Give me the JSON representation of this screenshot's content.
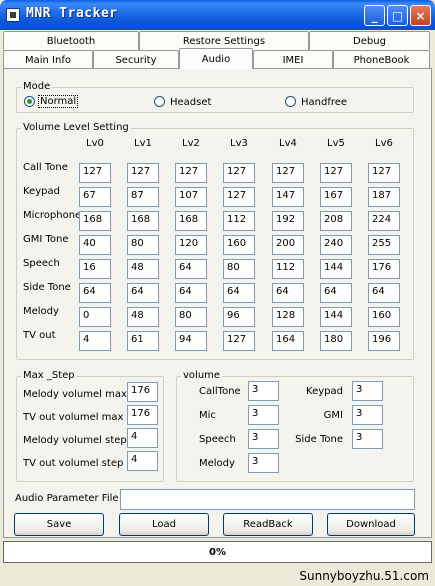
{
  "window": {
    "title": "MNR Tracker",
    "minimize": "_",
    "maximize": "□",
    "close": "×"
  },
  "tabs": {
    "row1": [
      "Bluetooth",
      "Restore Settings",
      "Debug"
    ],
    "row2": [
      "Main Info",
      "Security",
      "Audio",
      "IMEI",
      "PhoneBook"
    ],
    "active": "Audio"
  },
  "mode": {
    "title": "Mode",
    "options": [
      "Normal",
      "Headset",
      "Handfree"
    ],
    "selected": "Normal"
  },
  "volume_level": {
    "title": "Volume Level Setting",
    "columns": [
      "Lv0",
      "Lv1",
      "Lv2",
      "Lv3",
      "Lv4",
      "Lv5",
      "Lv6"
    ],
    "rows": [
      {
        "label": "Call Tone",
        "values": [
          "127",
          "127",
          "127",
          "127",
          "127",
          "127",
          "127"
        ]
      },
      {
        "label": "Keypad",
        "values": [
          "67",
          "87",
          "107",
          "127",
          "147",
          "167",
          "187"
        ]
      },
      {
        "label": "Microphone",
        "values": [
          "168",
          "168",
          "168",
          "112",
          "192",
          "208",
          "224"
        ]
      },
      {
        "label": "GMI Tone",
        "values": [
          "40",
          "80",
          "120",
          "160",
          "200",
          "240",
          "255"
        ]
      },
      {
        "label": "Speech",
        "values": [
          "16",
          "48",
          "64",
          "80",
          "112",
          "144",
          "176"
        ]
      },
      {
        "label": "Side Tone",
        "values": [
          "64",
          "64",
          "64",
          "64",
          "64",
          "64",
          "64"
        ]
      },
      {
        "label": "Melody",
        "values": [
          "0",
          "48",
          "80",
          "96",
          "128",
          "144",
          "160"
        ]
      },
      {
        "label": "TV out",
        "values": [
          "4",
          "61",
          "94",
          "127",
          "164",
          "180",
          "196"
        ]
      }
    ]
  },
  "max_step": {
    "title": "Max _Step",
    "rows": [
      {
        "label": "Melody volumel max",
        "value": "176"
      },
      {
        "label": "TV out volumel max",
        "value": "176"
      },
      {
        "label": "Melody volumel step",
        "value": "4"
      },
      {
        "label": "TV out volumel step",
        "value": "4"
      }
    ]
  },
  "volume": {
    "title": "volume",
    "left": [
      {
        "label": "CallTone",
        "value": "3"
      },
      {
        "label": "Mic",
        "value": "3"
      },
      {
        "label": "Speech",
        "value": "3"
      },
      {
        "label": "Melody",
        "value": "3"
      }
    ],
    "right": [
      {
        "label": "Keypad",
        "value": "3"
      },
      {
        "label": "GMI",
        "value": "3"
      },
      {
        "label": "Side Tone",
        "value": "3"
      }
    ]
  },
  "audio_param": {
    "label": "Audio Parameter File",
    "value": ""
  },
  "buttons": {
    "save": "Save",
    "load": "Load",
    "readback": "ReadBack",
    "download": "Download"
  },
  "progress": {
    "text": "0%",
    "fraction": 0
  },
  "watermark": "Sunnyboyzhu.51.com"
}
